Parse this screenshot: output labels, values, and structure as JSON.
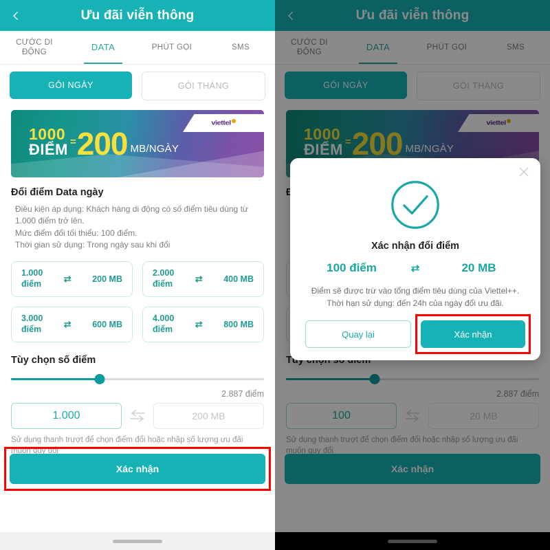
{
  "header": {
    "title": "Ưu đãi viễn thông",
    "back_icon": "chevron-left-icon",
    "bg_color": "#17B2B6"
  },
  "tabs": [
    {
      "label": "CƯỚC DI\nĐỘNG",
      "active": false
    },
    {
      "label": "DATA",
      "active": true
    },
    {
      "label": "PHÚT GỌI",
      "active": false
    },
    {
      "label": "SMS",
      "active": false
    }
  ],
  "package_toggle": {
    "daily_label": "GÓI NGÀY",
    "monthly_label": "GÓI THÁNG",
    "selected": "GÓI NGÀY"
  },
  "banner": {
    "points": "1000",
    "points_unit": "ĐIỂM",
    "equals": "=",
    "amount": "200",
    "amount_unit": "MB/NGÀY",
    "brand": "viettel"
  },
  "section": {
    "title": "Đổi điểm Data ngày",
    "lines": [
      "Điều kiện áp dụng: Khách hàng di động có số điểm tiêu dùng từ 1.000 điểm trở lên.",
      "Mức điểm đổi tối thiểu: 100 điểm.",
      "Thời gian sử dụng: Trong ngày sau khi đổi"
    ]
  },
  "option_cards": [
    {
      "points": "1.000",
      "points_unit": "điểm",
      "swap_icon": "exchange-icon",
      "data": "200 MB"
    },
    {
      "points": "2.000",
      "points_unit": "điểm",
      "swap_icon": "exchange-icon",
      "data": "400 MB"
    },
    {
      "points": "3.000",
      "points_unit": "điểm",
      "swap_icon": "exchange-icon",
      "data": "600 MB"
    },
    {
      "points": "4.000",
      "points_unit": "điểm",
      "swap_icon": "exchange-icon",
      "data": "800 MB"
    }
  ],
  "slider_section": {
    "title": "Tùy chọn số điểm",
    "max_label": "2.887 điểm",
    "percent": 35,
    "hint": "Sử dụng thanh trượt để chọn điểm đổi hoặc nhập số lượng ưu đãi muốn quy đổi"
  },
  "left_inputs": {
    "points_value": "1.000",
    "points_placeholder": "1.000",
    "swap_icon": "swap-horizontal-icon",
    "data_value": "200 MB",
    "data_placeholder": "200 MB"
  },
  "right_inputs": {
    "points_value": "100",
    "points_placeholder": "100",
    "swap_icon": "swap-horizontal-icon",
    "data_value": "20 MB",
    "data_placeholder": "20 MB"
  },
  "confirm": {
    "label": "Xác nhận"
  },
  "modal": {
    "close_icon": "close-icon",
    "check_icon": "check-circle-icon",
    "title": "Xác nhận đổi điểm",
    "left_value": "100 điểm",
    "swap_icon": "exchange-icon",
    "right_value": "20 MB",
    "note": "Điểm sẽ được trừ vào tổng điểm tiêu dùng của Viettel++. Thời hạn sử dụng: đến 24h của ngày đổi ưu đãi.",
    "back_label": "Quay lại",
    "confirm_label": "Xác nhận"
  },
  "annotation": {
    "highlight_color": "#ff0000"
  },
  "colors": {
    "teal": "#17B2B6",
    "teal_dark": "#0f9a9e",
    "accent_green": "#1f9c93",
    "yellow": "#f5e03c",
    "overlay": "rgba(0,0,0,0.46)"
  }
}
